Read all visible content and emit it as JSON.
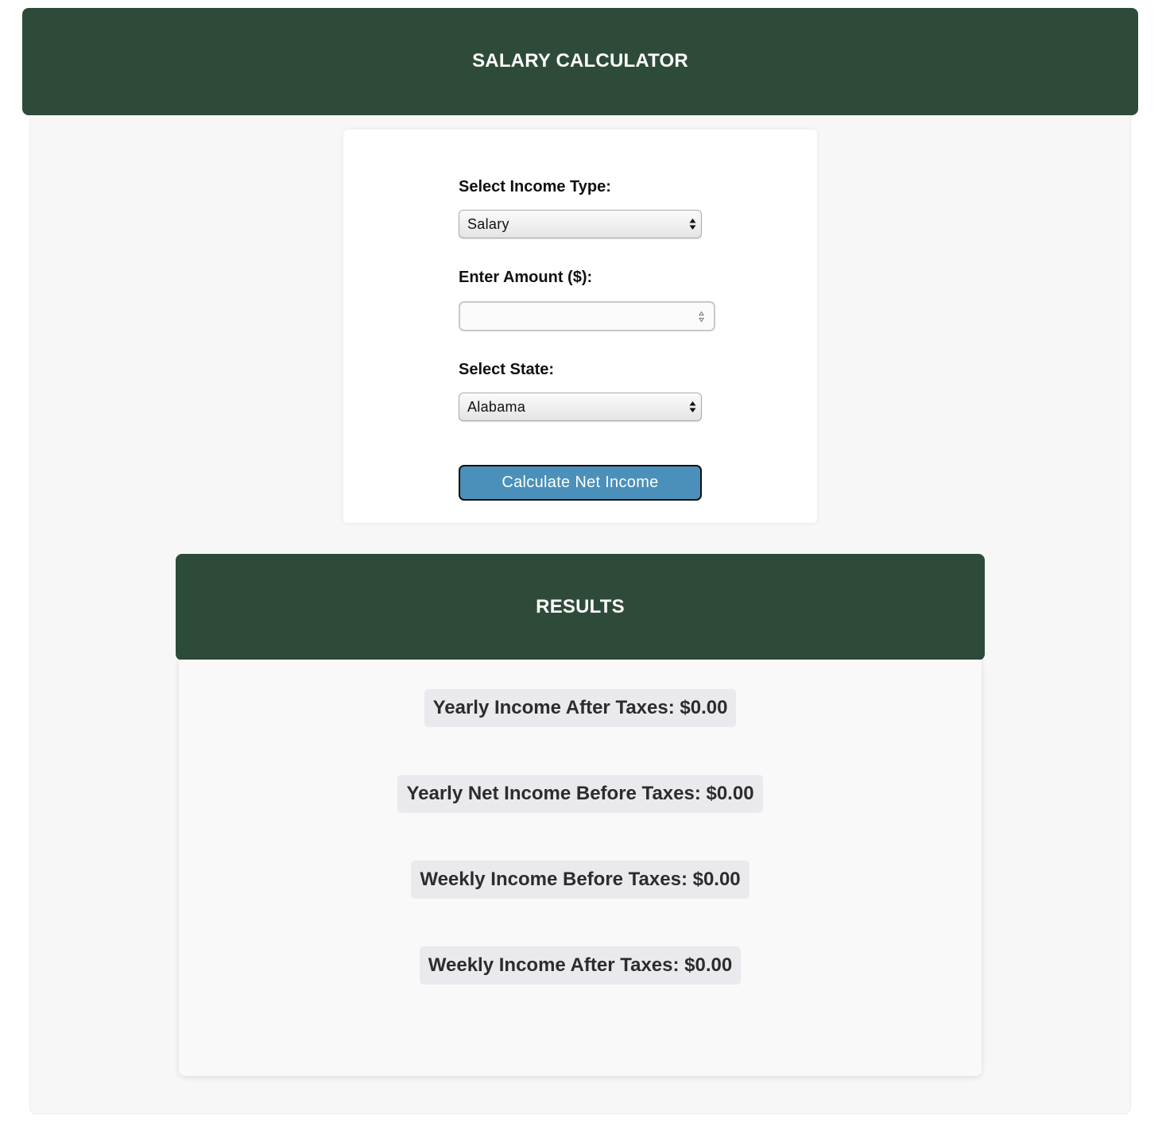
{
  "header": {
    "title": "SALARY CALCULATOR"
  },
  "form": {
    "income_type_label": "Select Income Type:",
    "income_type_value": "Salary",
    "amount_label": "Enter Amount ($):",
    "amount_value": "",
    "state_label": "Select State:",
    "state_value": "Alabama",
    "calculate_button": "Calculate Net Income"
  },
  "results": {
    "title": "RESULTS",
    "lines": [
      "Yearly Income After Taxes: $0.00",
      "Yearly Net Income Before Taxes: $0.00",
      "Weekly Income Before Taxes: $0.00",
      "Weekly Income After Taxes: $0.00"
    ]
  },
  "colors": {
    "header_green": "#2e4b39",
    "button_blue": "#4a90bb",
    "result_pill_bg": "#eaeaee"
  }
}
